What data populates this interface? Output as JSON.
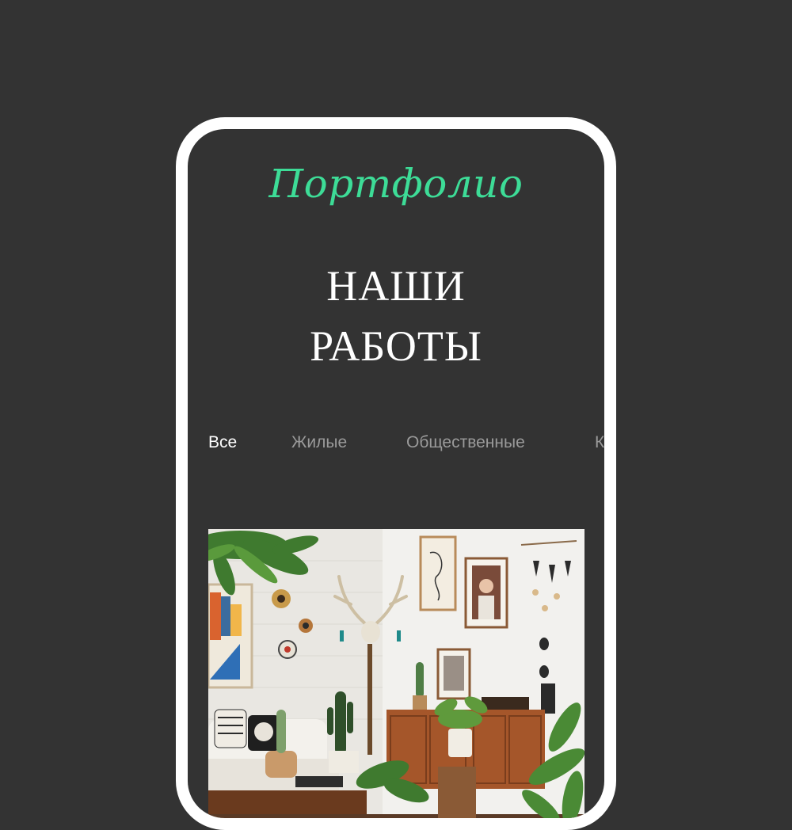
{
  "header": {
    "script_title": "Портфолио",
    "heading_line1": "НАШИ",
    "heading_line2": "РАБОТЫ"
  },
  "tabs": [
    {
      "label": "Все",
      "active": true
    },
    {
      "label": "Жилые",
      "active": false
    },
    {
      "label": "Общественные",
      "active": false
    },
    {
      "label": "К",
      "active": false
    }
  ],
  "colors": {
    "background": "#333333",
    "frame": "#ffffff",
    "accent": "#3ddc97",
    "tab_inactive": "#9a9a9a",
    "tab_active": "#ffffff"
  }
}
